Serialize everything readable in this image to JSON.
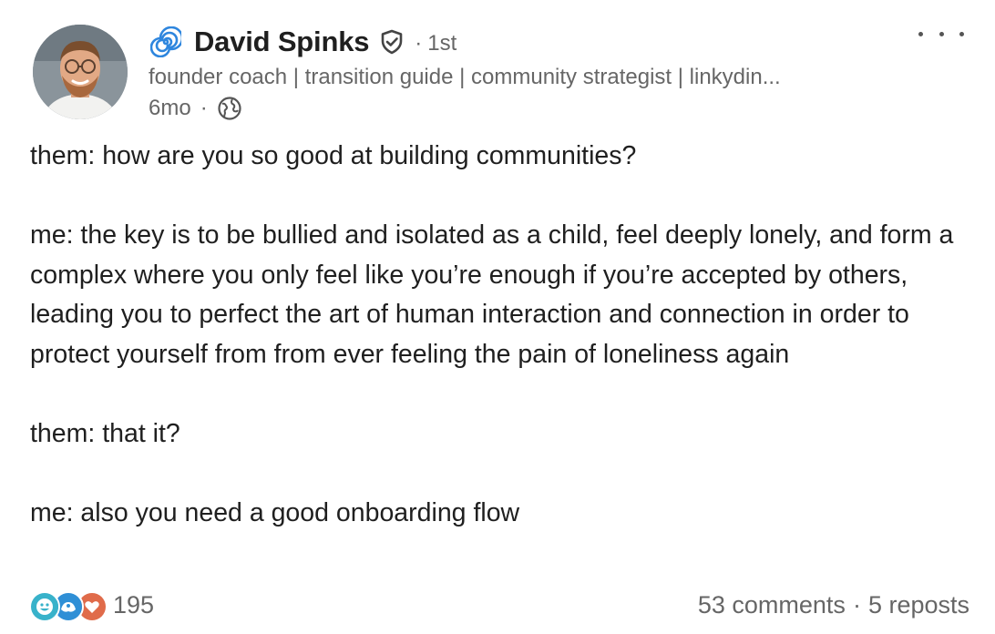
{
  "post": {
    "author": {
      "name": "David Spinks",
      "degree": "1st",
      "headline": "founder coach | transition guide | community strategist | linkydin...",
      "time": "6mo",
      "visibility_icon": "globe-icon",
      "verified_icon": "shield-check-icon",
      "badge_icon": "spiral-icon"
    },
    "menu_icon": "more-horizontal-icon",
    "paragraphs": [
      "them: how are you so good at building communities?",
      "me: the key is to be bullied and isolated as a child, feel deeply lonely, and form a complex where you only feel like you’re enough if you’re accepted by others, leading you to perfect the art of human interaction and connection in order to protect yourself from from ever feeling the pain of loneliness again",
      "them: that it?",
      "me: also you need a good onboarding flow"
    ],
    "reactions": {
      "count": "195",
      "icons": [
        "funny-icon",
        "support-icon",
        "love-icon"
      ]
    },
    "comments": "53 comments",
    "reposts": "5 reposts",
    "separator": "·"
  },
  "colors": {
    "text": "#1f1f1f",
    "muted": "#666666",
    "spiral": "#2e86de",
    "funny": "#38b2ca",
    "support": "#2f8fd6",
    "love": "#e06b4a"
  }
}
